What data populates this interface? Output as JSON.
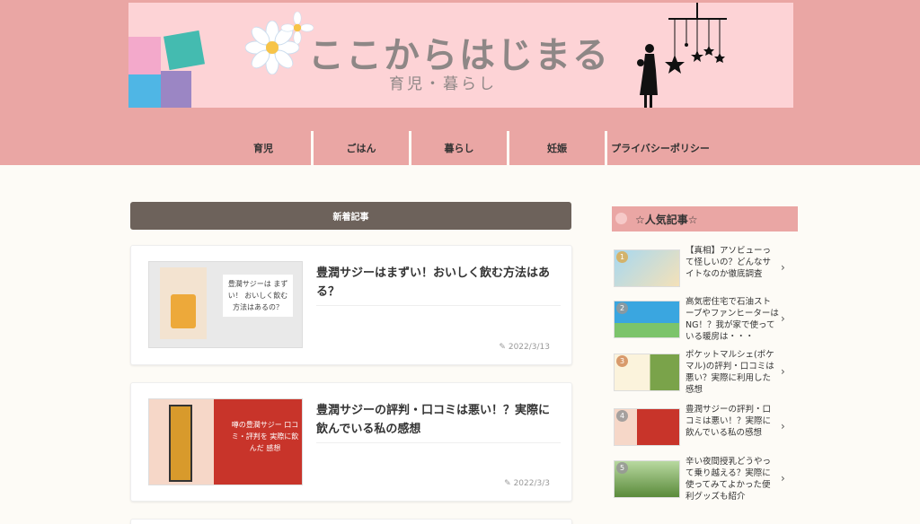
{
  "site": {
    "title": "ここからはじまる",
    "subtitle": "育児・暮らし"
  },
  "nav": {
    "items": [
      {
        "label": "育児"
      },
      {
        "label": "ごはん"
      },
      {
        "label": "暮らし"
      },
      {
        "label": "妊娠"
      },
      {
        "label": "プライバシーポリシー"
      }
    ]
  },
  "main": {
    "section_title": "新着記事",
    "articles": [
      {
        "title": "豊潤サジーはまずい！おいしく飲む方法はある？",
        "date": "2022/3/13",
        "thumb_text": "豊潤サジーは まずい！ おいしく飲む 方法はあるの？"
      },
      {
        "title": "豊潤サジーの評判・口コミは悪い！？実際に飲んでいる私の感想",
        "date": "2022/3/3",
        "thumb_text": "噂の豊潤サジー 口コミ・評判を 実際に飲んだ 感想"
      }
    ]
  },
  "sidebar": {
    "title": "☆人気記事☆",
    "items": [
      {
        "rank": "1",
        "text": "【真相】アソビューって怪しいの？どんなサイトなのか徹底調査"
      },
      {
        "rank": "2",
        "text": "高気密住宅で石油ストーブやファンヒーターはNG！？我が家で使っている暖房は・・・"
      },
      {
        "rank": "3",
        "text": "ポケットマルシェ(ポケマル)の評判・口コミは悪い？実際に利用した感想"
      },
      {
        "rank": "4",
        "text": "豊潤サジーの評判・口コミは悪い！？実際に飲んでいる私の感想"
      },
      {
        "rank": "5",
        "text": "辛い夜間授乳どうやって乗り越える？実際に使ってみてよかった便利グッズも紹介"
      }
    ]
  },
  "colors": {
    "header_bg": "#eaa6a4",
    "banner_bg": "#fdd3d6",
    "section_head_bg": "#6d625b",
    "page_bg": "#fdfbf6"
  },
  "icons": {
    "pencil": "pencil-icon",
    "chevron": "chevron-right-icon"
  }
}
